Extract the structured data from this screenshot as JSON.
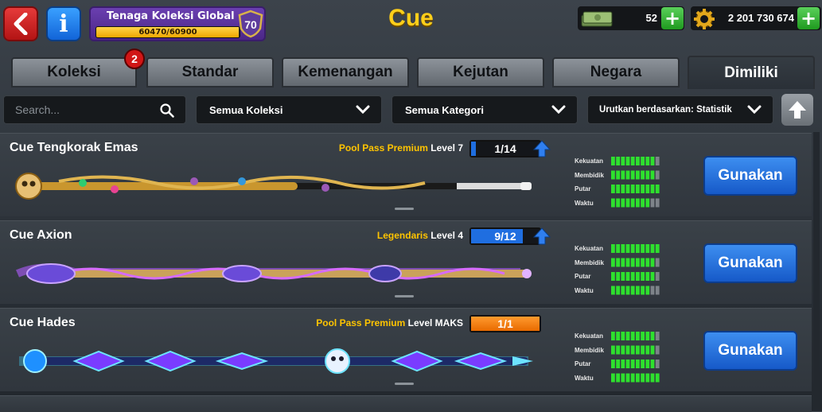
{
  "header": {
    "title": "Cue",
    "power_title": "Tenaga Koleksi Global",
    "power_progress": "60470/60900",
    "power_fraction": 0.993,
    "power_level": "70",
    "cash": "52",
    "coins": "2 201 730 674"
  },
  "tabs": [
    {
      "label": "Koleksi",
      "badge": "2"
    },
    {
      "label": "Standar"
    },
    {
      "label": "Kemenangan"
    },
    {
      "label": "Kejutan"
    },
    {
      "label": "Negara"
    },
    {
      "label": "Dimiliki",
      "active": true
    }
  ],
  "filters": {
    "search_placeholder": "Search...",
    "collection": "Semua Koleksi",
    "category": "Semua Kategori",
    "sort": "Urutkan berdasarkan: Statistik"
  },
  "stat_labels": [
    "Kekuatan",
    "Membidik",
    "Putar",
    "Waktu"
  ],
  "cues": [
    {
      "name": "Cue Tengkorak Emas",
      "tier": "Pool Pass Premium",
      "level": "Level 7",
      "progress": "1/14",
      "progress_fraction": 0.07,
      "can_upgrade": true,
      "stats": [
        9,
        9,
        10,
        8
      ],
      "button": "Gunakan"
    },
    {
      "name": "Cue Axion",
      "tier": "Legendaris",
      "level": "Level 4",
      "progress": "9/12",
      "progress_fraction": 0.75,
      "can_upgrade": true,
      "stats": [
        10,
        9,
        9,
        8
      ],
      "button": "Gunakan"
    },
    {
      "name": "Cue Hades",
      "tier": "Pool Pass Premium",
      "level": "Level MAKS",
      "progress": "1/1",
      "progress_fraction": 1.0,
      "can_upgrade": false,
      "stats": [
        9,
        9,
        9,
        10
      ],
      "button": "Gunakan"
    }
  ],
  "colors": {
    "accent_gold": "#ffcf1a",
    "use_button": "#1f6ee0",
    "stat_bar": "#2ee02e",
    "max_bar": "#ff8a1a"
  }
}
